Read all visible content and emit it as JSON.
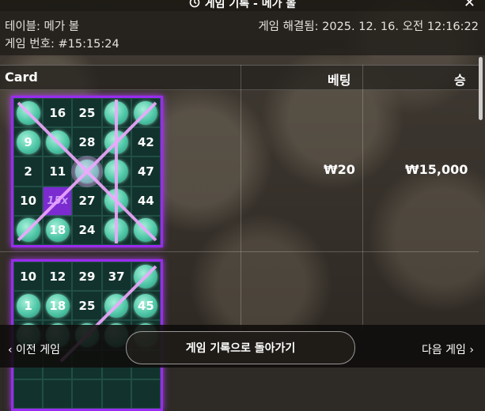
{
  "header": {
    "title": "게임 기록 - 메가 볼",
    "history_icon": "history-icon",
    "close_icon": "close-icon"
  },
  "info": {
    "table": "테이블: 메가 볼",
    "game_number": "게임 번호: #15:15:24",
    "resolved": "게임 해결됨: 2025. 12. 16. 오전 12:16:22"
  },
  "table": {
    "columns": [
      "Card",
      "베팅",
      "승"
    ],
    "rows": [
      {
        "bet": "₩20",
        "win": "₩15,000",
        "card": [
          [
            "",
            "16",
            "25",
            "",
            ""
          ],
          [
            "9",
            "",
            "28",
            "",
            "42"
          ],
          [
            "2",
            "11",
            "",
            "",
            "47"
          ],
          [
            "10",
            "15x",
            "27",
            "",
            "44"
          ],
          [
            "",
            "18",
            "24",
            "",
            ""
          ]
        ],
        "hits": [
          [
            1,
            0,
            0,
            1,
            1
          ],
          [
            1,
            1,
            0,
            1,
            0
          ],
          [
            0,
            0,
            1,
            1,
            0
          ],
          [
            0,
            0,
            0,
            1,
            0
          ],
          [
            1,
            1,
            0,
            1,
            1
          ]
        ]
      },
      {
        "bet": "",
        "win": "",
        "card": [
          [
            "10",
            "12",
            "29",
            "37",
            ""
          ],
          [
            "1",
            "18",
            "25",
            "",
            "45"
          ],
          [
            "",
            "",
            "",
            "",
            ""
          ],
          [
            "",
            "",
            "",
            "",
            ""
          ],
          [
            "",
            "",
            "",
            "",
            ""
          ]
        ],
        "hits": [
          [
            0,
            0,
            0,
            0,
            1
          ],
          [
            1,
            1,
            0,
            1,
            1
          ],
          [
            1,
            1,
            1,
            1,
            1
          ],
          [
            0,
            0,
            0,
            0,
            0
          ],
          [
            0,
            0,
            0,
            0,
            0
          ]
        ]
      }
    ]
  },
  "footer": {
    "prev": "‹  이전 게임",
    "back": "게임 기록으로 돌아가기",
    "next": "다음 게임  ›"
  },
  "colors": {
    "card_border": "#9a2bf0",
    "ball": "#4fc7a7",
    "line": "#f0a8ff"
  }
}
